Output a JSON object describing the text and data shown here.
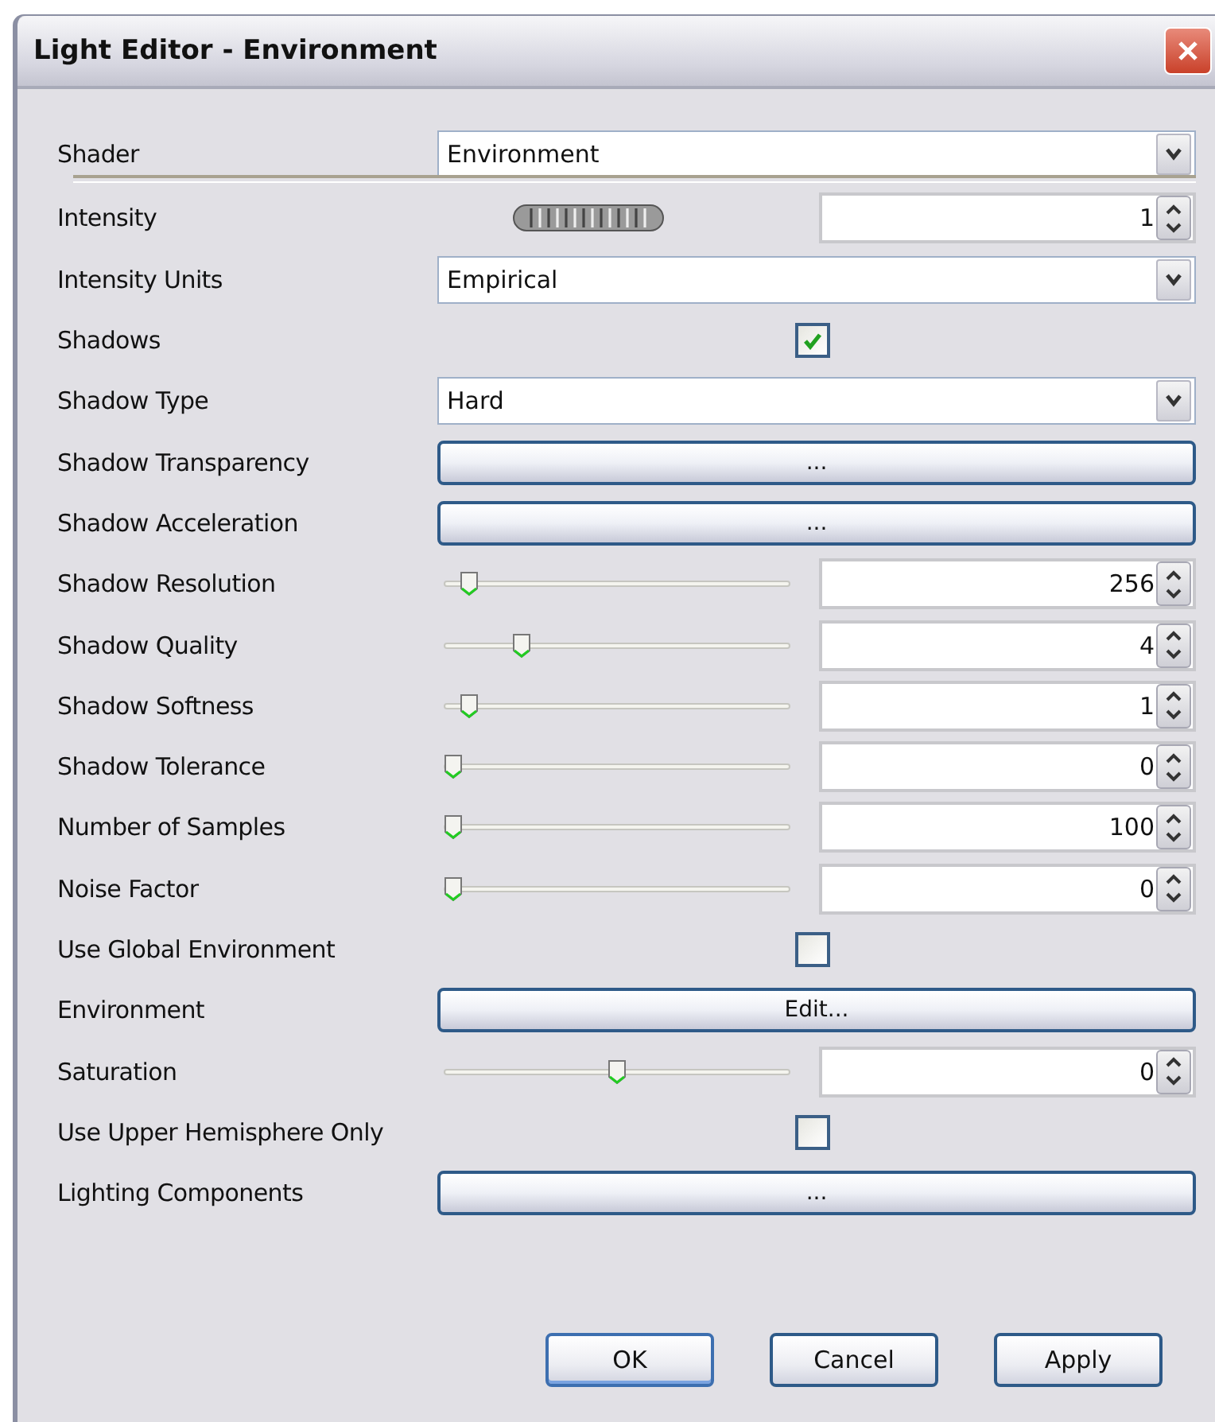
{
  "window": {
    "title": "Light Editor - Environment"
  },
  "rows": [
    {
      "kind": "dropdown",
      "label": "Shader",
      "value": "Environment"
    },
    {
      "kind": "knob",
      "label": "Intensity",
      "value": "1"
    },
    {
      "kind": "dropdown",
      "label": "Intensity Units",
      "value": "Empirical"
    },
    {
      "kind": "checkbox",
      "label": "Shadows",
      "checked": true
    },
    {
      "kind": "dropdown",
      "label": "Shadow Type",
      "value": "Hard"
    },
    {
      "kind": "button",
      "label": "Shadow Transparency",
      "button": "..."
    },
    {
      "kind": "button",
      "label": "Shadow Acceleration",
      "button": "..."
    },
    {
      "kind": "slider",
      "label": "Shadow Resolution",
      "level": 0.05,
      "value": "256"
    },
    {
      "kind": "slider",
      "label": "Shadow Quality",
      "level": 0.21,
      "value": "4"
    },
    {
      "kind": "slider",
      "label": "Shadow Softness",
      "level": 0.05,
      "value": "1"
    },
    {
      "kind": "slider",
      "label": "Shadow Tolerance",
      "level": 0,
      "value": "0"
    },
    {
      "kind": "slider",
      "label": "Number of Samples",
      "level": 0,
      "value": "100"
    },
    {
      "kind": "slider",
      "label": "Noise Factor",
      "level": 0,
      "value": "0"
    },
    {
      "kind": "checkbox",
      "label": "Use Global Environment",
      "checked": false
    },
    {
      "kind": "button",
      "label": "Environment",
      "button": "Edit..."
    },
    {
      "kind": "slider",
      "label": "Saturation",
      "level": 0.5,
      "value": "0"
    },
    {
      "kind": "checkbox",
      "label": "Use Upper Hemisphere Only",
      "checked": false
    },
    {
      "kind": "button",
      "label": "Lighting Components",
      "button": "..."
    }
  ],
  "buttons": [
    "OK",
    "Cancel",
    "Apply"
  ]
}
